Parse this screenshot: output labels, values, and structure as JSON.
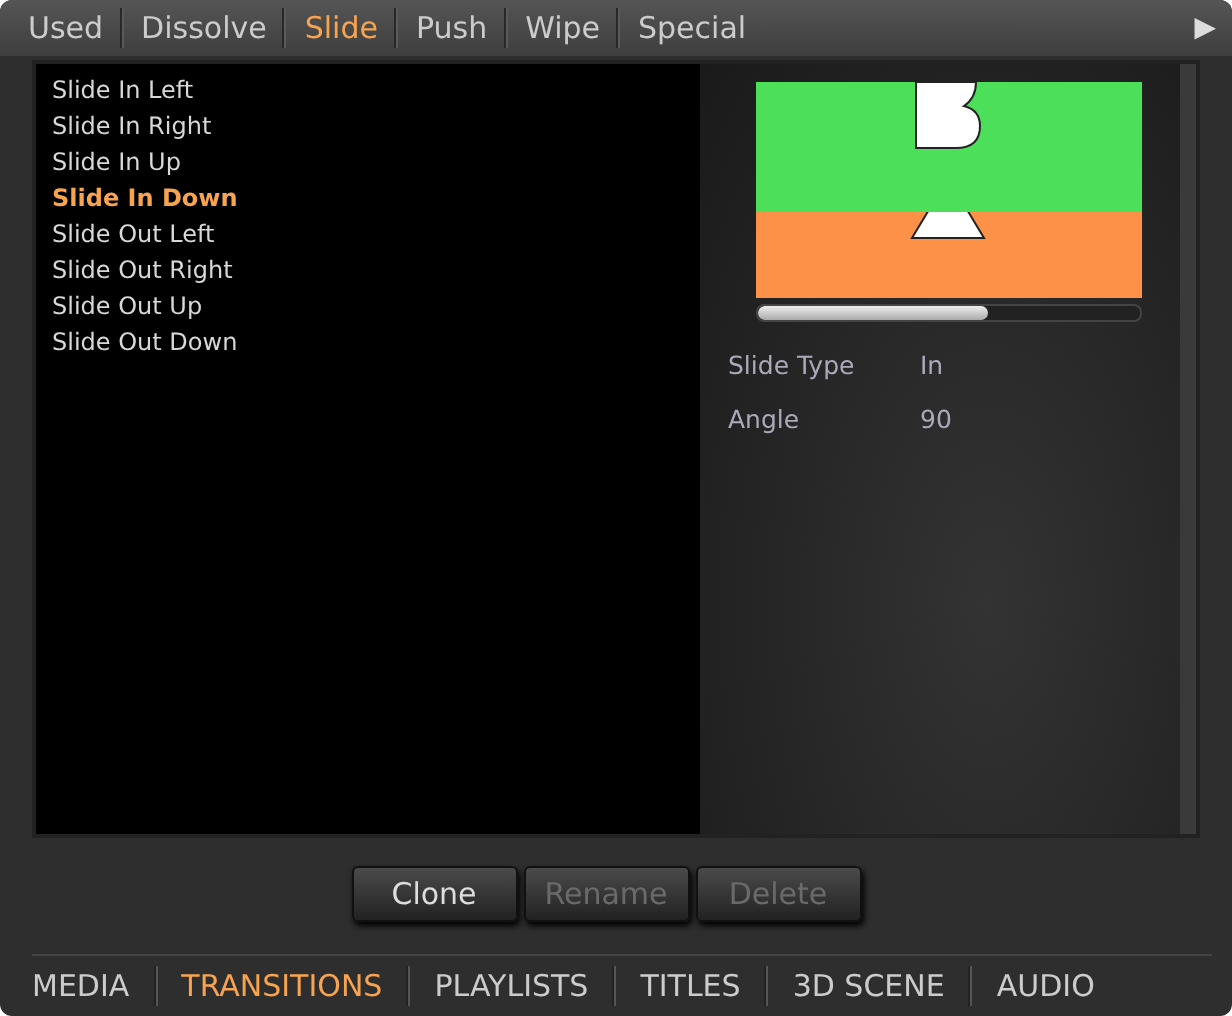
{
  "tabs": [
    {
      "label": "Used",
      "selected": false
    },
    {
      "label": "Dissolve",
      "selected": false
    },
    {
      "label": "Slide",
      "selected": true
    },
    {
      "label": "Push",
      "selected": false
    },
    {
      "label": "Wipe",
      "selected": false
    },
    {
      "label": "Special",
      "selected": false
    }
  ],
  "tabs_more": "▶",
  "transitions": [
    {
      "label": "Slide In Left",
      "selected": false
    },
    {
      "label": "Slide In Right",
      "selected": false
    },
    {
      "label": "Slide In Up",
      "selected": false
    },
    {
      "label": "Slide In Down",
      "selected": true
    },
    {
      "label": "Slide Out Left",
      "selected": false
    },
    {
      "label": "Slide Out Right",
      "selected": false
    },
    {
      "label": "Slide Out Up",
      "selected": false
    },
    {
      "label": "Slide Out Down",
      "selected": false
    }
  ],
  "preview": {
    "kind": "picture",
    "level": 0.6
  },
  "properties": [
    {
      "label": "Slide Type",
      "value": "In"
    },
    {
      "label": "Angle",
      "value": "90"
    }
  ],
  "buttons": [
    {
      "label": "Clone",
      "disabled": false
    },
    {
      "label": "Rename",
      "disabled": true
    },
    {
      "label": "Delete",
      "disabled": true
    }
  ],
  "bottom_tabs": [
    {
      "label": "MEDIA",
      "selected": false
    },
    {
      "label": "TRANSITIONS",
      "selected": true
    },
    {
      "label": "PLAYLISTS",
      "selected": false
    },
    {
      "label": "TITLES",
      "selected": false
    },
    {
      "label": "3D SCENE",
      "selected": false
    },
    {
      "label": "AUDIO",
      "selected": false
    }
  ]
}
